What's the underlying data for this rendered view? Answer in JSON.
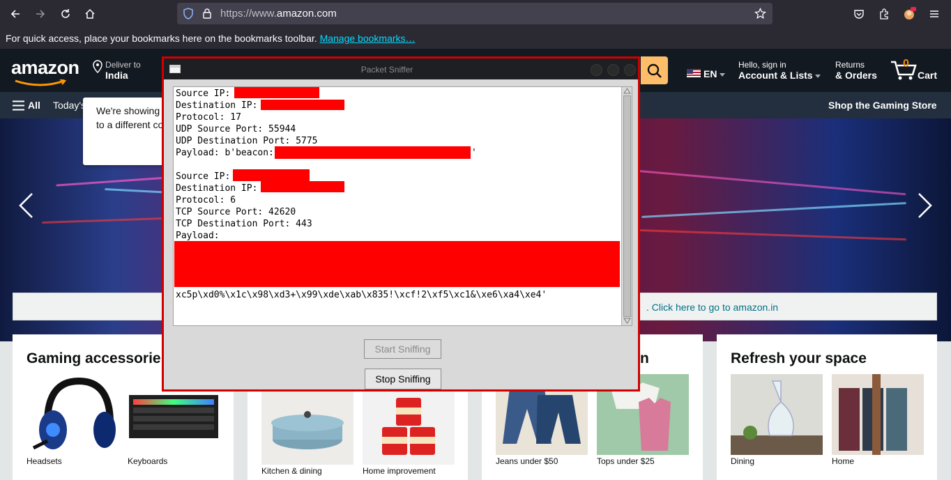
{
  "browser": {
    "url_prefix": "https://www.",
    "url_domain": "amazon.com",
    "bookmarks_text": "For quick access, place your bookmarks here on the bookmarks toolbar.",
    "bookmarks_link": "Manage bookmarks…",
    "icons": [
      "back-icon",
      "forward-icon",
      "reload-icon",
      "home-icon",
      "shield-icon",
      "lock-icon",
      "star-icon",
      "pocket-icon",
      "extensions-icon",
      "account-icon",
      "menu-icon"
    ]
  },
  "amazon": {
    "logo": "amazon",
    "deliver_label": "Deliver to",
    "deliver_country": "India",
    "lang": "EN",
    "account_line1": "Hello, sign in",
    "account_line2": "Account & Lists",
    "returns_line1": "Returns",
    "returns_line2": "& Orders",
    "cart_count": "0",
    "cart_label": "Cart",
    "all_label": "All",
    "subnav_item": "Today's",
    "subnav_right": "Shop the Gaming Store",
    "popover_line1": "We're showing",
    "popover_line2": "to a different co",
    "notice_link": ". Click here to go to amazon.in",
    "cards": [
      {
        "title": "Gaming accessorie",
        "items": [
          "Headsets",
          "Keyboards"
        ]
      },
      {
        "title": "",
        "items": [
          "Kitchen & dining",
          "Home improvement"
        ]
      },
      {
        "title": "n",
        "items": [
          "Jeans under $50",
          "Tops under $25"
        ]
      },
      {
        "title": "Refresh your space",
        "items": [
          "Dining",
          "Home"
        ]
      }
    ]
  },
  "sniffer": {
    "title": "Packet Sniffer",
    "lines": [
      "Source IP:",
      "Destination IP:",
      "Protocol: 17",
      "UDP Source Port: 55944",
      "UDP Destination Port: 5775",
      "Payload: b'beacon:",
      "",
      "Source IP:",
      "Destination IP:",
      "Protocol: 6",
      "TCP Source Port: 42620",
      "TCP Destination Port: 443",
      "Payload:"
    ],
    "payload_close": "'",
    "tail_line": "xc5p\\xd0%\\x1c\\x98\\xd3+\\x99\\xde\\xab\\x835!\\xcf!2\\xf5\\xc1&\\xe6\\xa4\\xe4'",
    "start_button": "Start Sniffing",
    "stop_button": "Stop Sniffing",
    "redaction_color": "#ff0000"
  }
}
